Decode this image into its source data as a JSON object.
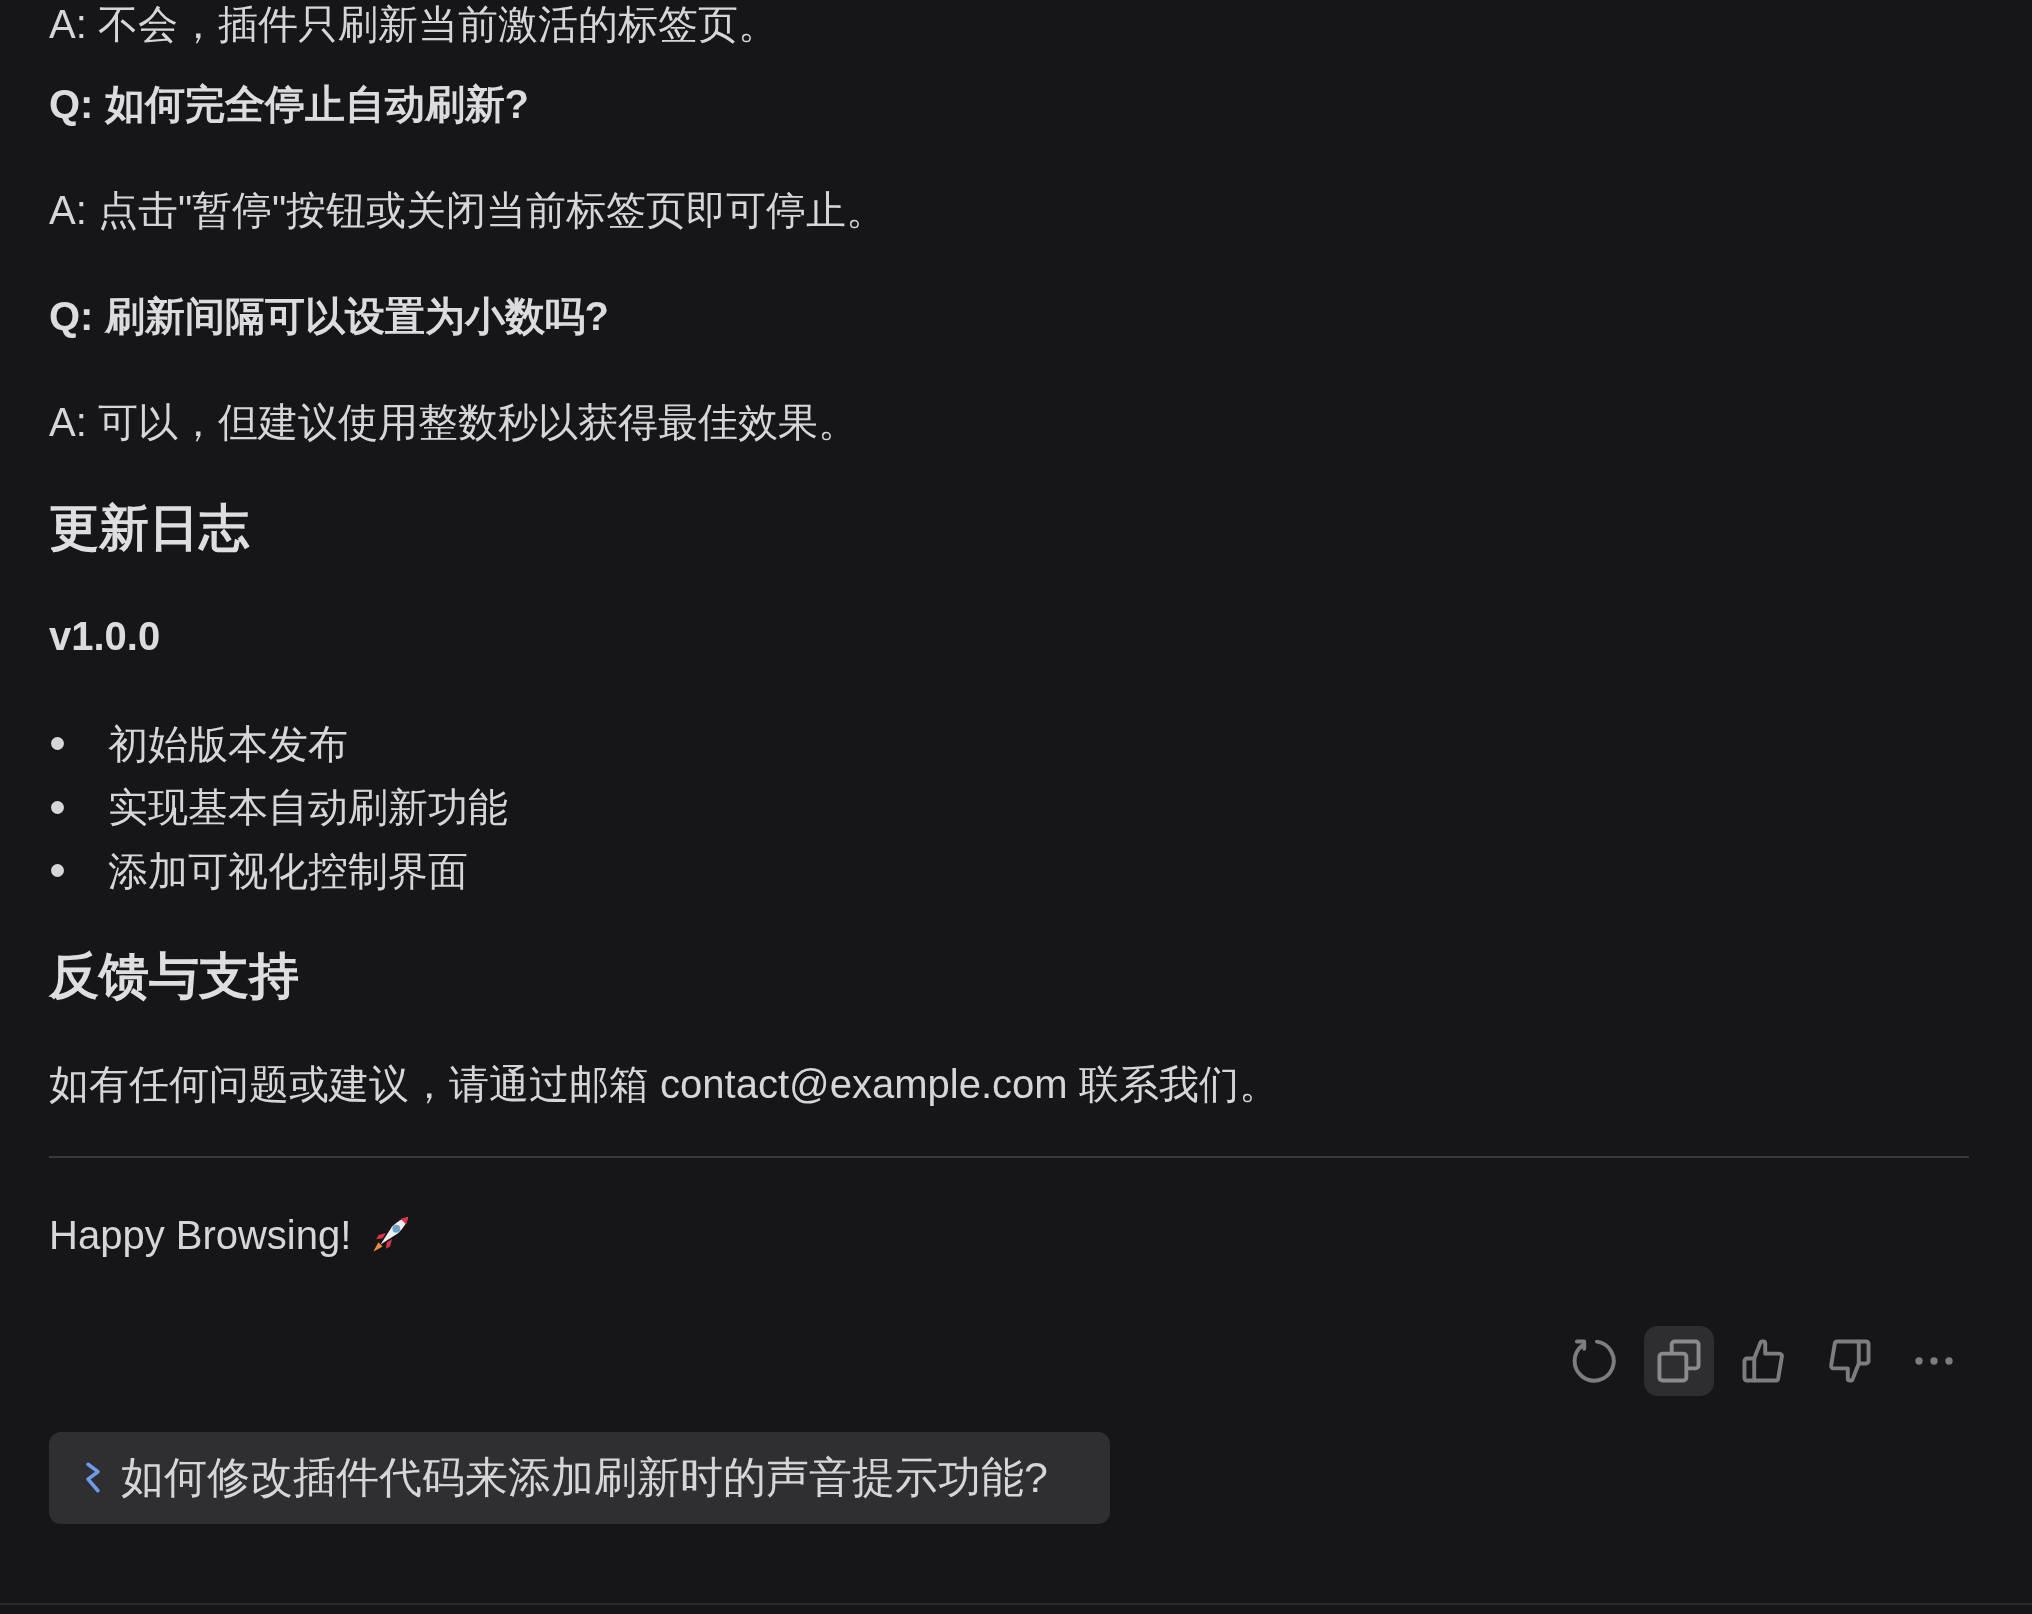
{
  "faq": [
    {
      "kind": "answer",
      "text": "A: 不会，插件只刷新当前激活的标签页。"
    },
    {
      "kind": "question",
      "text": "Q: 如何完全停止自动刷新?"
    },
    {
      "kind": "answer",
      "text": "A: 点击\"暂停\"按钮或关闭当前标签页即可停止。"
    },
    {
      "kind": "question",
      "text": "Q: 刷新间隔可以设置为小数吗?"
    },
    {
      "kind": "answer",
      "text": "A: 可以，但建议使用整数秒以获得最佳效果。"
    }
  ],
  "changelog": {
    "heading": "更新日志",
    "releases": [
      {
        "version": "v1.0.0",
        "changes": [
          "初始版本发布",
          "实现基本自动刷新功能",
          "添加可视化控制界面"
        ]
      }
    ]
  },
  "feedback": {
    "heading": "反馈与支持",
    "text": "如有任何问题或建议，请通过邮箱 contact@example.com 联系我们。"
  },
  "closing": {
    "text": "Happy Browsing!"
  },
  "message_actions": [
    {
      "kind": "regenerate",
      "highlighted": false
    },
    {
      "kind": "copy",
      "highlighted": true
    },
    {
      "kind": "like",
      "highlighted": false
    },
    {
      "kind": "dislike",
      "highlighted": false
    },
    {
      "kind": "more",
      "highlighted": false
    }
  ],
  "suggestion": {
    "text": "如何修改插件代码来添加刷新时的声音提示功能?"
  }
}
